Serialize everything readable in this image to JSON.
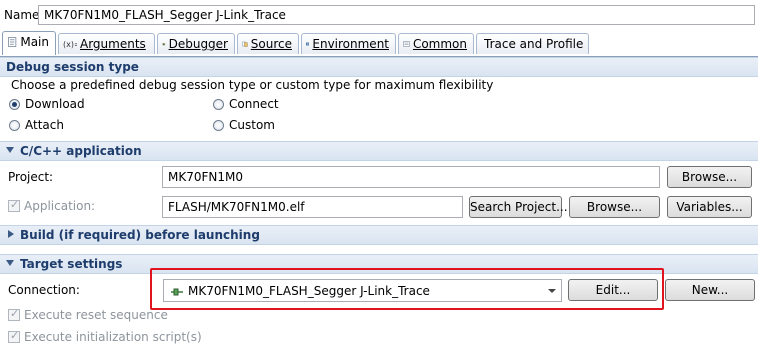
{
  "name": {
    "label": "Name:",
    "value": "MK70FN1M0_FLASH_Segger J-Link_Trace"
  },
  "tabs": [
    {
      "label": "Main",
      "icon": "main-tab-icon",
      "active": true
    },
    {
      "label": "Arguments",
      "icon": "arguments-icon"
    },
    {
      "label": "Debugger",
      "icon": "debugger-icon"
    },
    {
      "label": "Source",
      "icon": "source-icon"
    },
    {
      "label": "Environment",
      "icon": "environment-icon"
    },
    {
      "label": "Common",
      "icon": "common-icon"
    },
    {
      "label": "Trace and Profile",
      "icon": "trace-profile-icon"
    }
  ],
  "debug_session": {
    "title": "Debug session type",
    "description": "Choose a predefined debug session type or custom type for maximum flexibility",
    "options": [
      {
        "label": "Download",
        "selected": true
      },
      {
        "label": "Connect",
        "selected": false
      },
      {
        "label": "Attach",
        "selected": false
      },
      {
        "label": "Custom",
        "selected": false
      }
    ]
  },
  "cpp_app": {
    "title": "C/C++ application",
    "project_label": "Project:",
    "project_value": "MK70FN1M0",
    "browse1": "Browse...",
    "application_label": "Application:",
    "application_value": "FLASH/MK70FN1M0.elf",
    "search_project": "Search Project...",
    "browse2": "Browse...",
    "variables": "Variables..."
  },
  "build": {
    "title": "Build (if required) before launching"
  },
  "target": {
    "title": "Target settings",
    "connection_label": "Connection:",
    "connection_value": "MK70FN1M0_FLASH_Segger J-Link_Trace",
    "edit": "Edit...",
    "new": "New...",
    "reset_label": "Execute reset sequence",
    "init_label": "Execute initialization script(s)"
  },
  "colors": {
    "highlight": "#e0141e",
    "section_title": "#1e3c6c"
  }
}
